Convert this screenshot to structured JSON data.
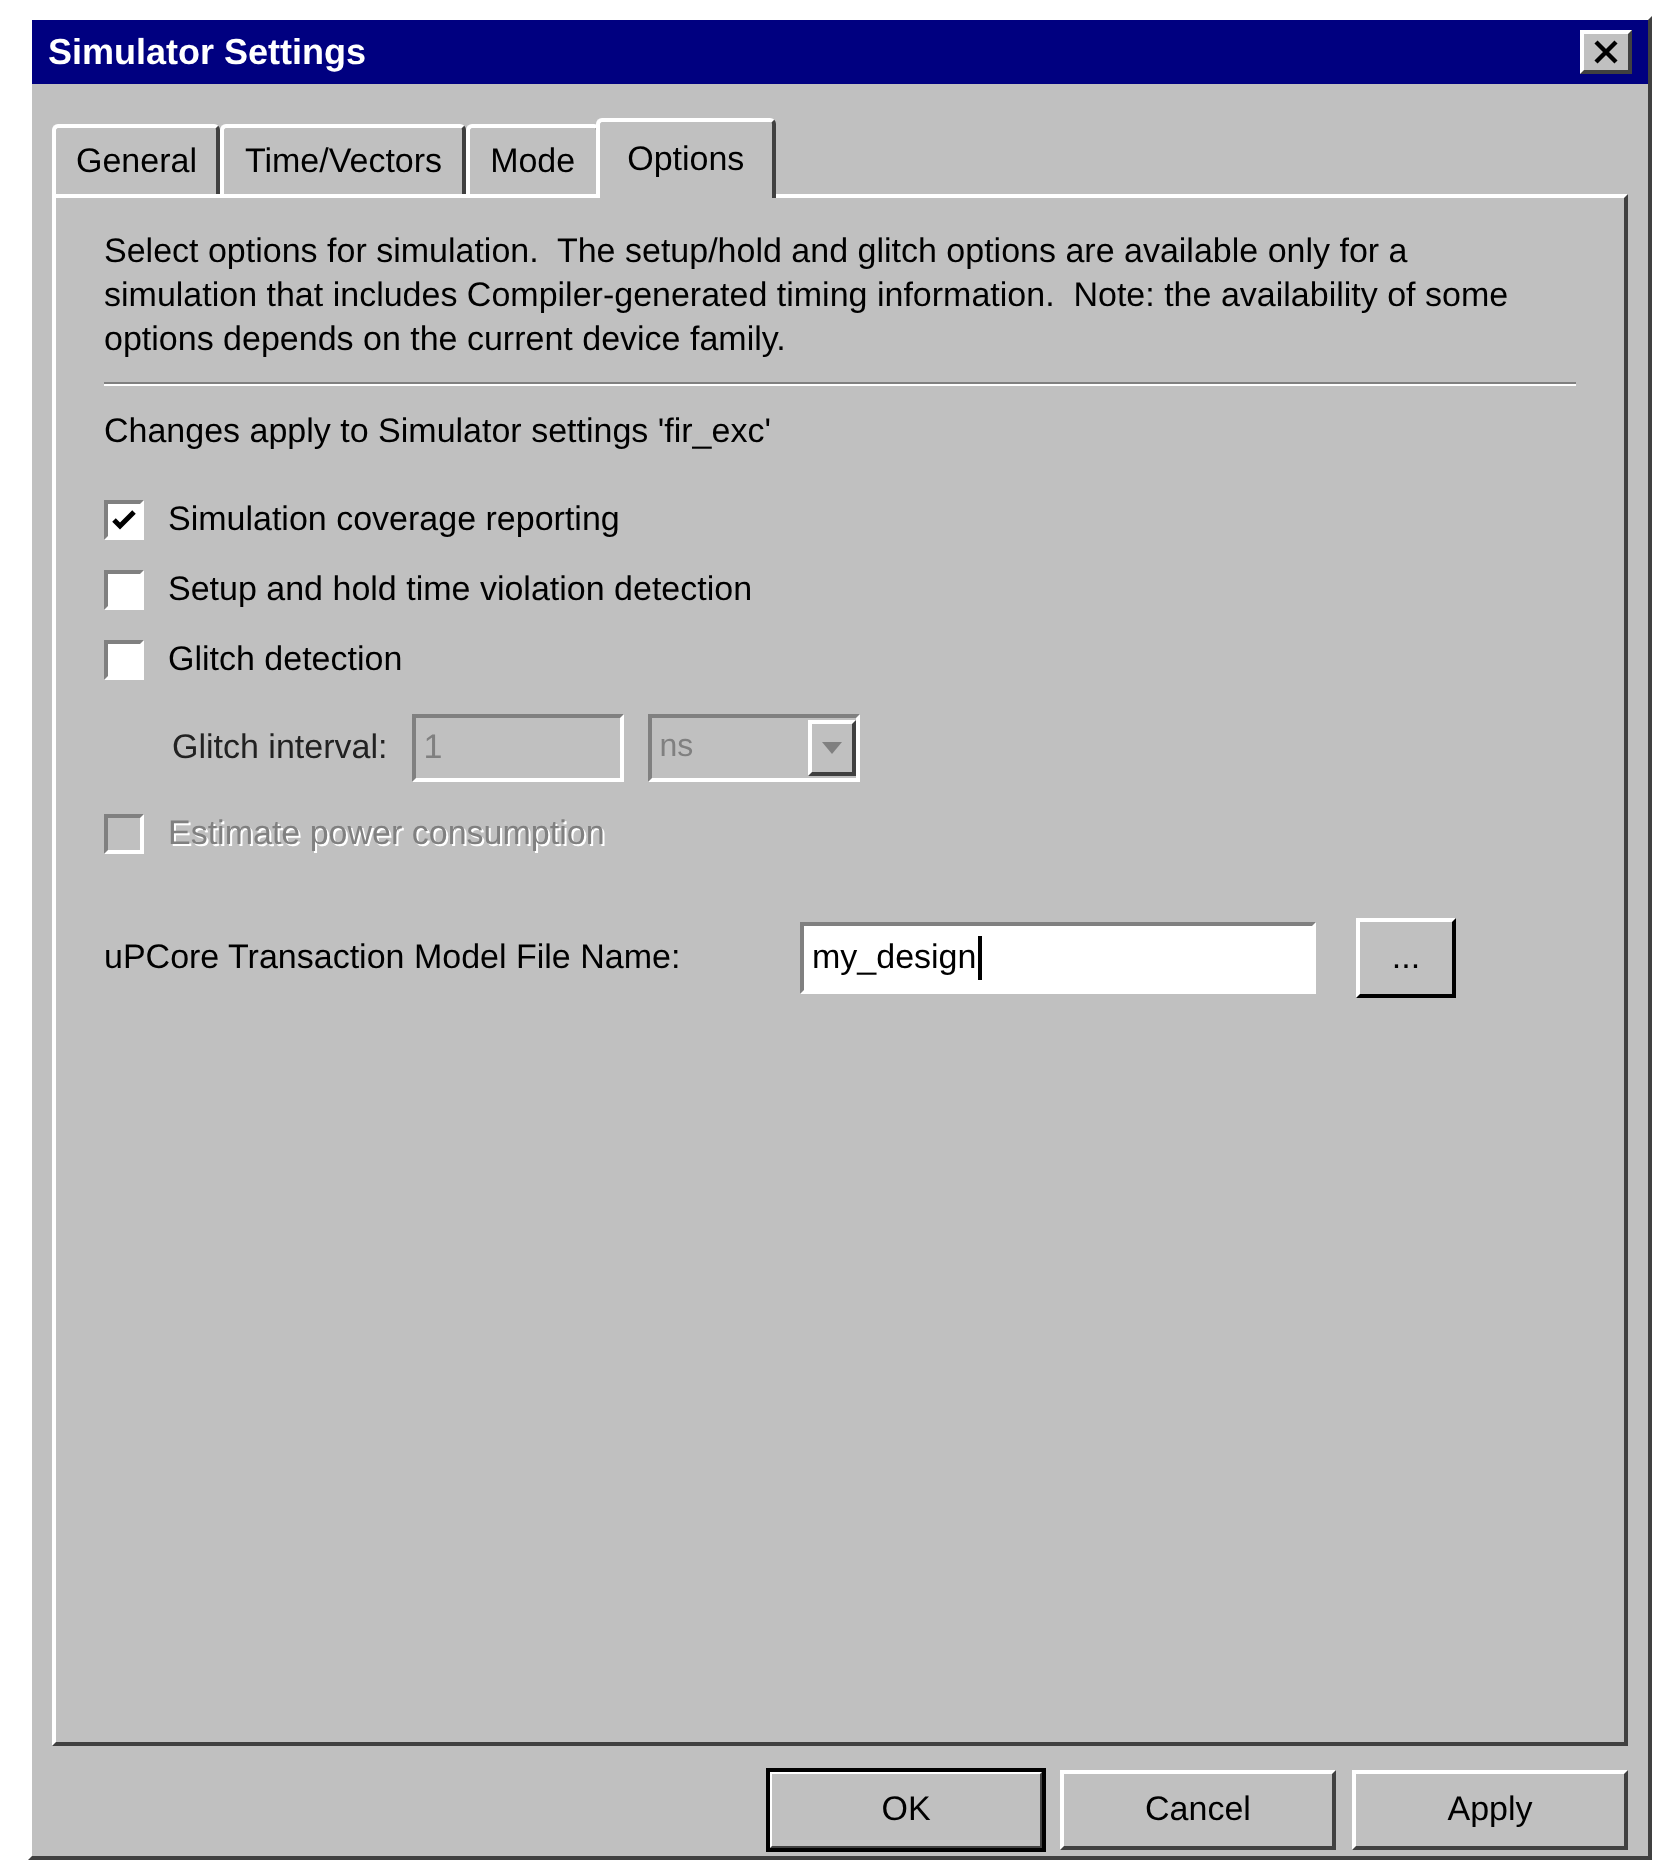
{
  "window": {
    "title": "Simulator Settings"
  },
  "tabs": [
    {
      "label": "General",
      "selected": false
    },
    {
      "label": "Time/Vectors",
      "selected": false
    },
    {
      "label": "Mode",
      "selected": false
    },
    {
      "label": "Options",
      "selected": true
    }
  ],
  "description": "Select options for simulation.  The setup/hold and glitch options are available only for a simulation that includes Compiler-generated timing information.  Note: the availability of some options depends on the current device family.",
  "changes_note": "Changes apply to Simulator settings 'fir_exc'",
  "options": [
    {
      "kind": "checkbox",
      "label": "Simulation coverage reporting",
      "checked": true,
      "disabled": false
    },
    {
      "kind": "checkbox",
      "label": "Setup and hold time violation detection",
      "checked": false,
      "disabled": false
    },
    {
      "kind": "checkbox",
      "label": "Glitch detection",
      "checked": false,
      "disabled": false
    },
    {
      "kind": "interval",
      "label": "Glitch interval:",
      "value": "1",
      "unit": "ns",
      "disabled": true
    },
    {
      "kind": "checkbox",
      "label": "Estimate power consumption",
      "checked": false,
      "disabled": true
    }
  ],
  "model_file": {
    "label": "uPCore Transaction Model File Name:",
    "value": "my_design",
    "browse": "..."
  },
  "buttons": [
    {
      "label": "OK",
      "default": true
    },
    {
      "label": "Cancel",
      "default": false
    },
    {
      "label": "Apply",
      "default": false
    }
  ]
}
